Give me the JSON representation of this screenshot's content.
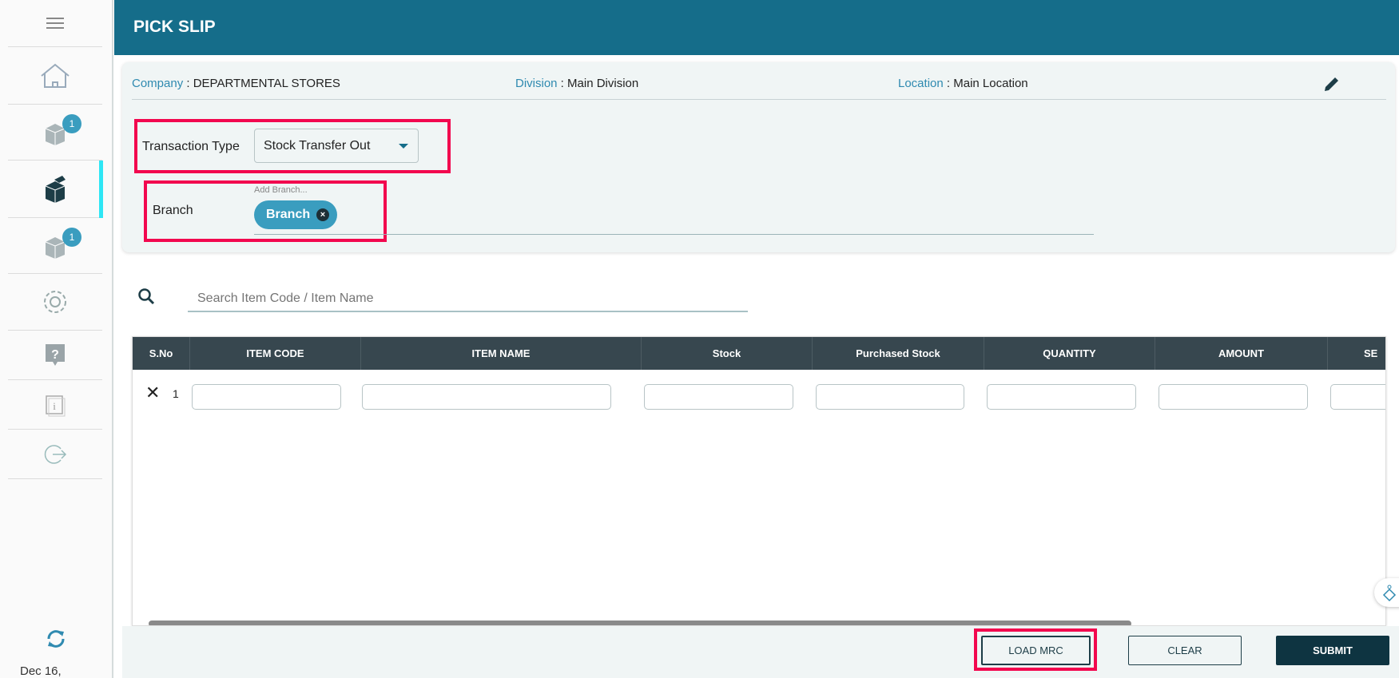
{
  "sidebar": {
    "items": [
      {
        "name": "home",
        "badge": null
      },
      {
        "name": "inbound-box",
        "badge": "1"
      },
      {
        "name": "pick-slip",
        "badge": null,
        "active": true
      },
      {
        "name": "outbound-box",
        "badge": "1"
      },
      {
        "name": "settings",
        "badge": null
      },
      {
        "name": "help",
        "badge": null
      },
      {
        "name": "info",
        "badge": null
      },
      {
        "name": "logout",
        "badge": null
      }
    ],
    "date": "Dec 16,"
  },
  "header": {
    "title": "PICK SLIP"
  },
  "context": {
    "company_label": "Company",
    "company_value": "DEPARTMENTAL STORES",
    "division_label": "Division",
    "division_value": "Main Division",
    "location_label": "Location",
    "location_value": "Main Location",
    "sep": " : "
  },
  "form": {
    "transaction_type_label": "Transaction Type",
    "transaction_type_value": "Stock Transfer Out",
    "branch_label": "Branch",
    "branch_placeholder": "Add Branch...",
    "branch_chip": "Branch"
  },
  "search": {
    "placeholder": "Search Item Code / Item Name"
  },
  "table": {
    "columns": [
      "S.No",
      "ITEM CODE",
      "ITEM NAME",
      "Stock",
      "Purchased Stock",
      "QUANTITY",
      "AMOUNT",
      "SE"
    ],
    "rows": [
      {
        "sno": "1"
      }
    ]
  },
  "footer": {
    "load_mrc": "LOAD MRC",
    "clear": "CLEAR",
    "submit": "SUBMIT"
  },
  "colors": {
    "header": "#156d8a",
    "accent": "#2f8ab0",
    "table_header": "#37474f",
    "highlight": "#f2074e"
  }
}
